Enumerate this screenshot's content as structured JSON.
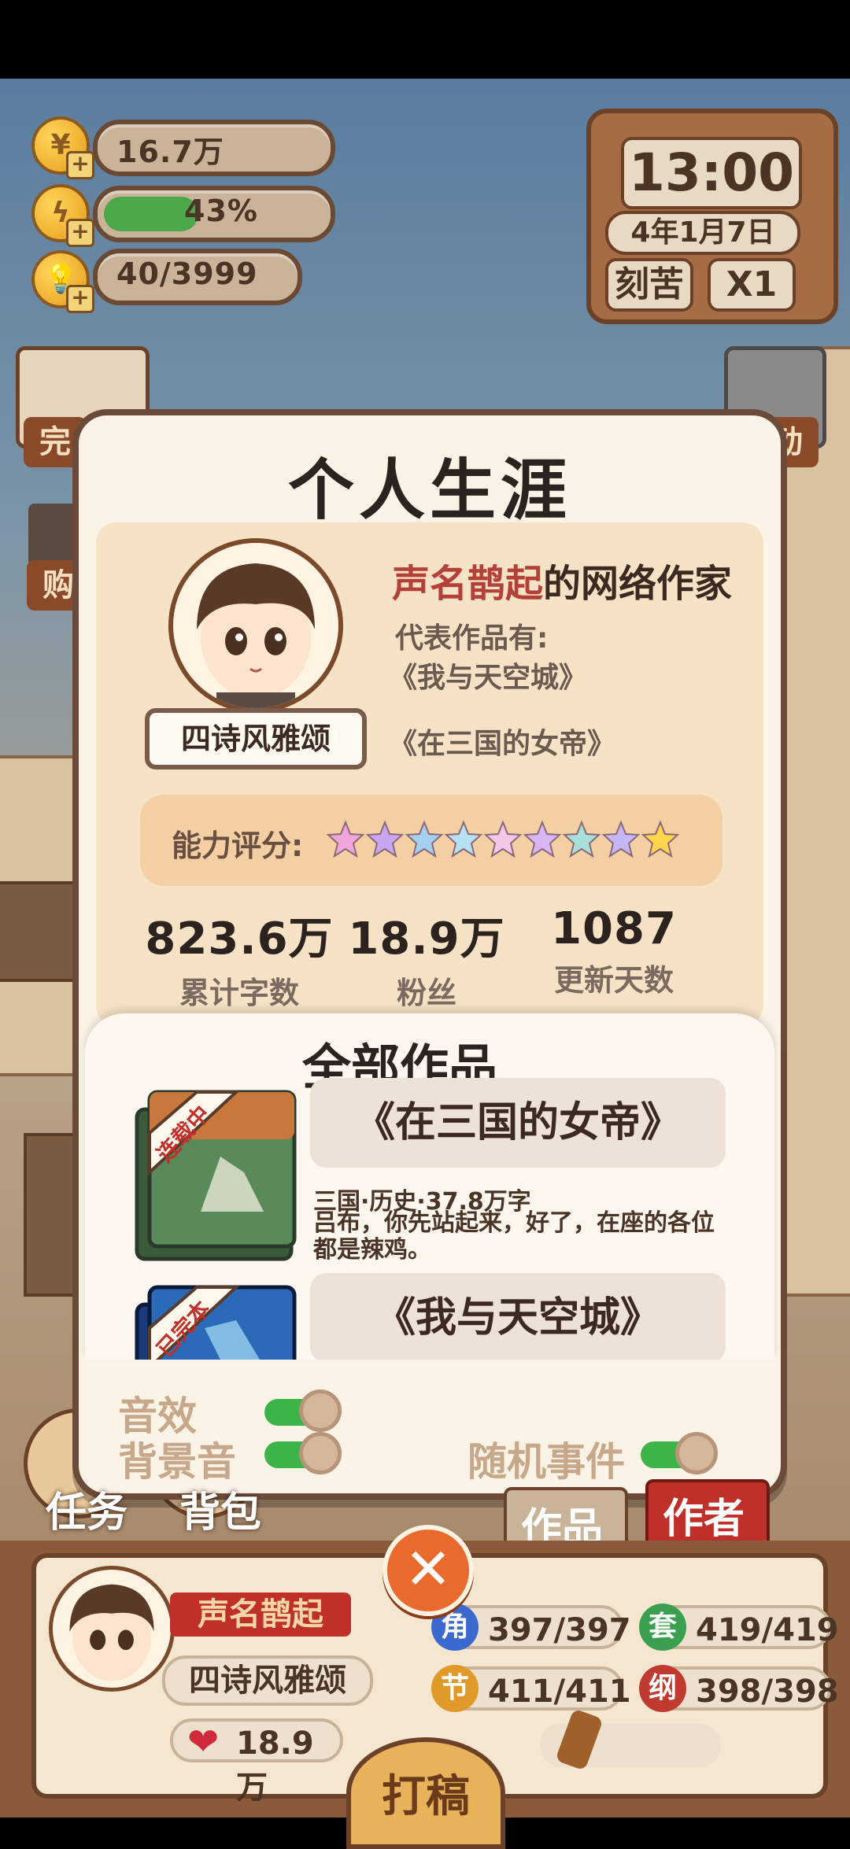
{
  "hud": {
    "coins": "16.7万",
    "energy_percent": "43%",
    "energy_fill": 0.43,
    "inspiration": "40/3999",
    "icons": [
      "coin-icon",
      "lightning-icon",
      "bulb-icon"
    ]
  },
  "clock": {
    "time": "13:00",
    "date": "4年1月7日",
    "mode_button": "刻苦",
    "speed_button": "X1"
  },
  "modal": {
    "title": "个人生涯",
    "author_title_highlight": "声名鹊起",
    "author_title_suffix": "的网络作家",
    "rep_works_label": "代表作品有:",
    "rep_work_1": "《我与天空城》",
    "rep_work_2": "《在三国的女帝》",
    "pen_name": "四诗风雅颂",
    "ability_label": "能力评分:",
    "ability_stars": 9,
    "stats": [
      {
        "value": "823.6万",
        "label": "累计字数"
      },
      {
        "value": "18.9万",
        "label": "粉丝"
      },
      {
        "value": "1087",
        "label": "更新天数"
      }
    ],
    "works_title": "全部作品",
    "works": [
      {
        "ribbon": "连载中",
        "name": "《在三国的女帝》",
        "meta": "三国·历史·37.8万字",
        "desc": "吕布，你先站起来，好了，在座的各位都是辣鸡。",
        "cover_color": "#5a8a5a"
      },
      {
        "ribbon": "已完本",
        "name": "《我与天空城》",
        "meta": "",
        "desc": "",
        "cover_color": "#2a6ab8"
      }
    ],
    "toggles": {
      "sound_effects": "音效",
      "bgm": "背景音",
      "random_events": "随机事件"
    }
  },
  "bottom": {
    "tabs": [
      "任务",
      "背包",
      "作品",
      "作者"
    ],
    "rank_title": "声名鹊起",
    "pen_name": "四诗风雅颂",
    "fans": "18.9万",
    "stat_pills": [
      {
        "badge": "角",
        "value": "397/397",
        "color": "#3a6ad0"
      },
      {
        "badge": "套",
        "value": "419/419",
        "color": "#3aa050"
      },
      {
        "badge": "节",
        "value": "411/411",
        "color": "#e09a2a"
      },
      {
        "badge": "纲",
        "value": "398/398",
        "color": "#c03a30"
      }
    ],
    "write_button": "打稿"
  }
}
